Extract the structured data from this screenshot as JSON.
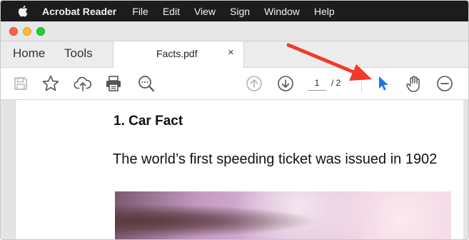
{
  "menubar": {
    "app_name": "Acrobat Reader",
    "items": [
      "File",
      "Edit",
      "View",
      "Sign",
      "Window",
      "Help"
    ]
  },
  "tabs": {
    "home": "Home",
    "tools": "Tools",
    "document": {
      "filename": "Facts.pdf",
      "close": "×"
    }
  },
  "toolbar": {
    "icons": [
      "save-icon",
      "bookmark-star-icon",
      "cloud-upload-icon",
      "print-icon",
      "zoom-search-icon",
      "previous-page-icon",
      "next-page-icon",
      "select-cursor-icon",
      "hand-tool-icon",
      "zoom-out-icon"
    ],
    "page_current": "1",
    "page_total": "/ 2",
    "active_tool_color": "#1a73e8"
  },
  "document": {
    "heading": "1. Car Fact",
    "paragraph": "The world’s first speeding ticket was issued in 1902"
  },
  "annotation": {
    "arrow_color": "#f03a2a"
  }
}
